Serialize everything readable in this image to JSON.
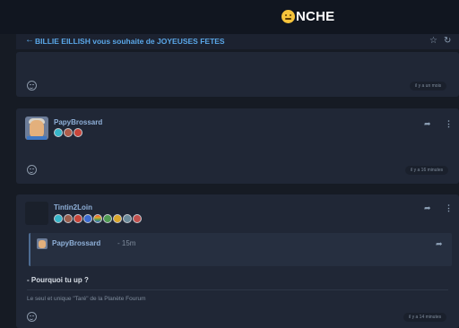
{
  "header": {
    "logo_text": "NCHE",
    "logo_icon": "smiley-face-icon"
  },
  "topic": {
    "back_icon": "arrow-left-icon",
    "title": "BILLIE EILLISH vous souhaite de JOYEUSES FETES",
    "actions": [
      {
        "icon": "star-icon",
        "glyph": "☆"
      },
      {
        "icon": "refresh-icon",
        "glyph": "↻"
      }
    ]
  },
  "posts": [
    {
      "author": "",
      "time": "il y a un mois"
    },
    {
      "author": "PapyBrossard",
      "badges": [
        "#37b6c9",
        "#b05d4a",
        "#c8453a"
      ],
      "time": "il y a 16 minutes"
    },
    {
      "author": "Tintin2Loin",
      "badges": [
        "#37b6c9",
        "#9a5f4e",
        "#c8453a",
        "#3b6bd1",
        "#e3a62a",
        "#4f9a52",
        "#d9a52b",
        "#6b8a9a",
        "#c0504d"
      ],
      "quote": {
        "author": "PapyBrossard",
        "time": "- 15m"
      },
      "message": "- Pourquoi tu up ?",
      "signature": "Le seul et unique \"Taré\" de la Planète Fourum",
      "time": "il y a 14 minutes"
    }
  ],
  "icons": {
    "share": "share-arrow-icon",
    "more": "more-vertical-icon",
    "emoji": "add-reaction-icon"
  },
  "colors": {
    "background": "#161b24",
    "card": "#202736",
    "accent": "#5aa7e8",
    "username": "#8fb0d8"
  }
}
